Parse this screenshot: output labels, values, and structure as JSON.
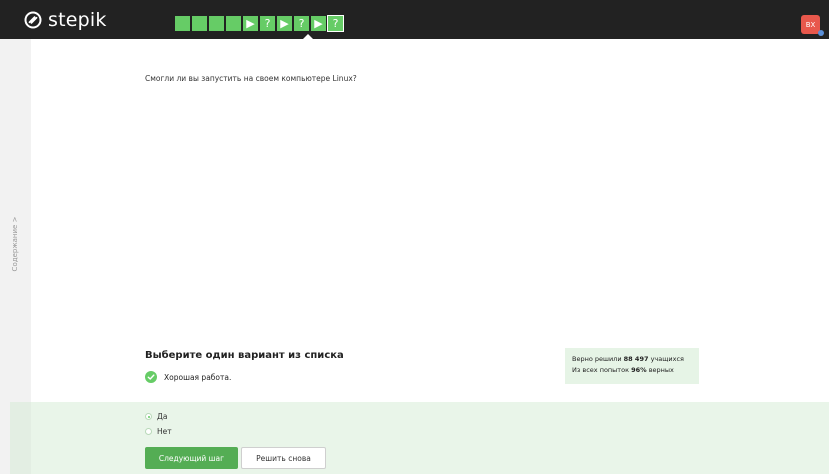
{
  "app": {
    "logo_text": "stepik",
    "avatar_initials": "BX",
    "brand_color": "#66cc66",
    "topbar_color": "#222222"
  },
  "steps": [
    {
      "type": "text",
      "glyph": "",
      "state": "passed"
    },
    {
      "type": "text",
      "glyph": "",
      "state": "passed"
    },
    {
      "type": "text",
      "glyph": "",
      "state": "passed"
    },
    {
      "type": "text",
      "glyph": "",
      "state": "passed"
    },
    {
      "type": "video",
      "glyph": "▶",
      "state": "passed"
    },
    {
      "type": "quiz",
      "glyph": "?",
      "state": "passed"
    },
    {
      "type": "video",
      "glyph": "▶",
      "state": "passed"
    },
    {
      "type": "quiz",
      "glyph": "?",
      "state": "passed"
    },
    {
      "type": "video",
      "glyph": "▶",
      "state": "passed"
    },
    {
      "type": "quiz",
      "glyph": "?",
      "state": "current"
    }
  ],
  "sidebar": {
    "label": "Содержание >"
  },
  "step": {
    "question": "Смогли ли вы запустить на своем компьютере Linux?",
    "task_title": "Выберите один вариант из списка",
    "feedback": "Хорошая работа."
  },
  "stats": {
    "line1_prefix": "Верно решили ",
    "solved_count": "88 497",
    "line1_suffix": " учащихся",
    "line2_prefix": "Из всех попыток ",
    "success_rate": "96%",
    "line2_suffix": " верных"
  },
  "options": [
    {
      "label": "Да",
      "checked": true
    },
    {
      "label": "Нет",
      "checked": false
    }
  ],
  "buttons": {
    "next": "Следующий шаг",
    "retry": "Решить снова"
  }
}
